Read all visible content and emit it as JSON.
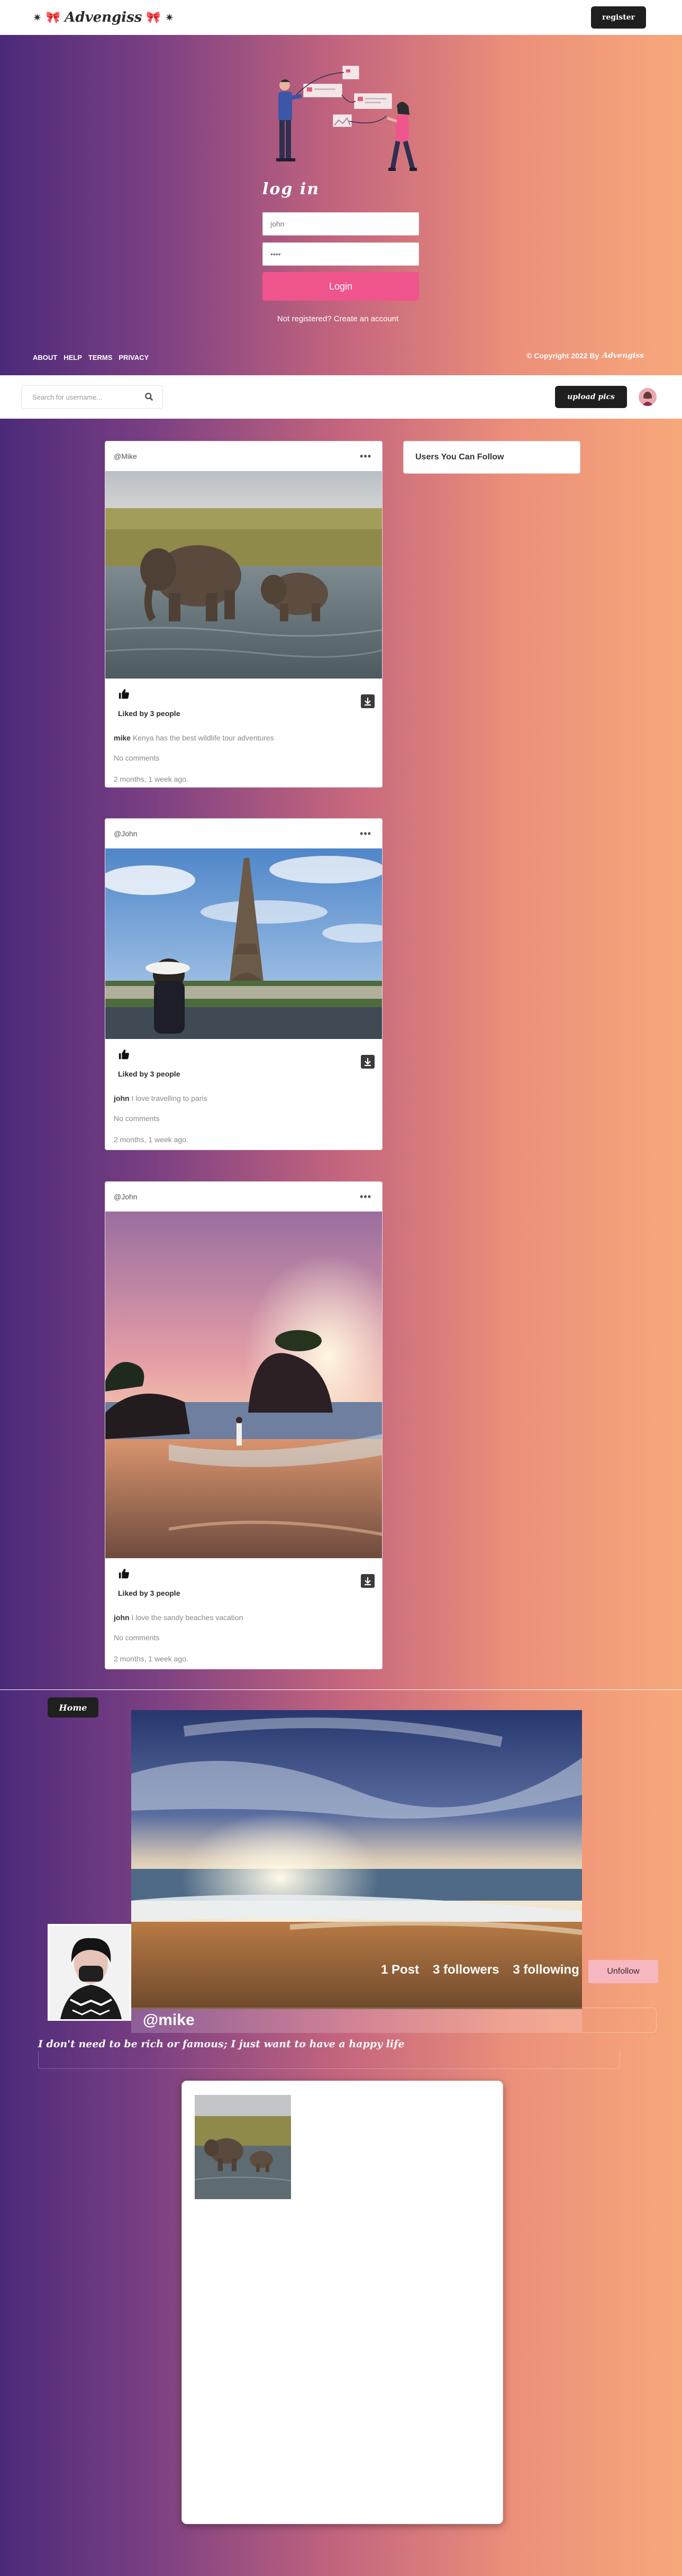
{
  "header": {
    "brand": "Advengiss",
    "register_label": "register"
  },
  "login": {
    "title": "log in",
    "username_value": "john",
    "password_value": "••••",
    "submit_label": "Login",
    "register_link": "Not registered? Create an account",
    "footer_links": [
      "ABOUT",
      "HELP",
      "TERMS",
      "PRIVACY"
    ],
    "copyright_prefix": "© Copyright 2022 By",
    "copyright_brand": "Advengiss"
  },
  "nav": {
    "search_placeholder": "Search for username...",
    "upload_label": "upload pics"
  },
  "feed": {
    "suggestions_title": "Users You Can Follow",
    "posts": [
      {
        "author": "@Mike",
        "liked_by": "Liked by 3 people",
        "caption_user": "mike",
        "caption_text": "Kenya has the best wildlife tour adventures",
        "comments": "No comments",
        "time": "2 months, 1 week ago."
      },
      {
        "author": "@John",
        "liked_by": "Liked by 3 people",
        "caption_user": "john",
        "caption_text": "I love travelling to paris",
        "comments": "No comments",
        "time": "2 months, 1 week ago."
      },
      {
        "author": "@John",
        "liked_by": "Liked by 3 people",
        "caption_user": "john",
        "caption_text": "I love the sandy beaches vacation",
        "comments": "No comments",
        "time": "2 months, 1 week ago."
      }
    ]
  },
  "profile": {
    "home_label": "Home",
    "posts_stat": "1 Post",
    "followers_stat": "3 followers",
    "following_stat": "3 following",
    "unfollow_label": "Unfollow",
    "username": "@mike",
    "bio": "I don't need to be rich or famous; I just want to have a happy life"
  },
  "colors": {
    "gradient_start": "#4b2a7a",
    "gradient_end": "#f7a87b",
    "accent_pink": "#f0548c",
    "dark_button": "#1f1f1f"
  }
}
